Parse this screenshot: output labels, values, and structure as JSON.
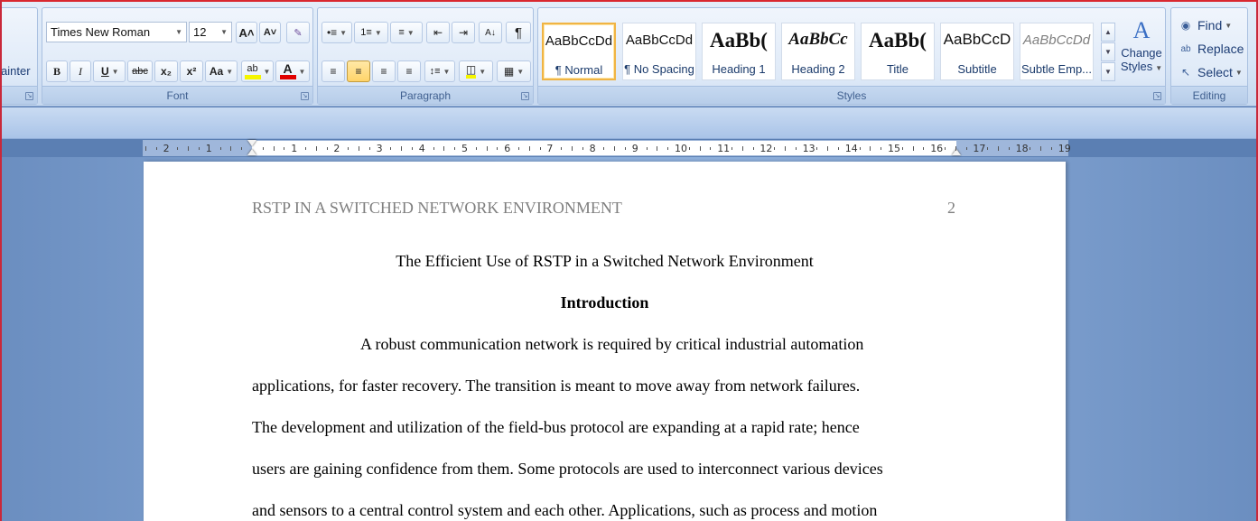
{
  "clipboard": {
    "format_painter_label": "ainter"
  },
  "font": {
    "group_label": "Font",
    "family": "Times New Roman",
    "size": "12",
    "grow_glyph": "A˄",
    "shrink_glyph": "A˅",
    "bold": "B",
    "italic": "I",
    "underline": "U",
    "strikethrough": "abc",
    "subscript": "x₂",
    "superscript": "x²",
    "change_case": "Aa",
    "highlight": "ab",
    "font_color": "A",
    "highlight_color": "#f5f500",
    "font_color_value": "#e00000"
  },
  "paragraph": {
    "group_label": "Paragraph"
  },
  "styles": {
    "group_label": "Styles",
    "items": [
      {
        "sample": "AaBbCcDd",
        "name": "¶ Normal"
      },
      {
        "sample": "AaBbCcDd",
        "name": "¶ No Spacing"
      },
      {
        "sample": "AaBb(",
        "name": "Heading 1"
      },
      {
        "sample": "AaBbCc",
        "name": "Heading 2"
      },
      {
        "sample": "AaBb(",
        "name": "Title"
      },
      {
        "sample": "AaBbCcD",
        "name": "Subtitle"
      },
      {
        "sample": "AaBbCcDd",
        "name": "Subtle Emp..."
      }
    ],
    "change_styles_line1": "Change",
    "change_styles_line2": "Styles"
  },
  "editing": {
    "group_label": "Editing",
    "find": "Find",
    "replace": "Replace",
    "select": "Select"
  },
  "ruler": {
    "labels": [
      "2",
      "1",
      "1",
      "2",
      "3",
      "4",
      "5",
      "6",
      "7",
      "8",
      "9",
      "10",
      "11",
      "12",
      "13",
      "14",
      "15",
      "16",
      "17",
      "18",
      "19"
    ]
  },
  "document": {
    "running_head": "RSTP IN A SWITCHED NETWORK ENVIRONMENT",
    "page_number": "2",
    "title": "The Efficient Use of RSTP in a Switched Network Environment",
    "heading": "Introduction",
    "lines": [
      "A robust communication network is required by critical industrial automation",
      "applications, for faster recovery. The transition is meant to move away from network failures.",
      "The development and utilization of the field-bus protocol are expanding at a rapid rate; hence",
      "users are gaining confidence from them. Some protocols are used to interconnect various devices",
      "and sensors to a central control system and each other. Applications, such as process and motion"
    ]
  }
}
